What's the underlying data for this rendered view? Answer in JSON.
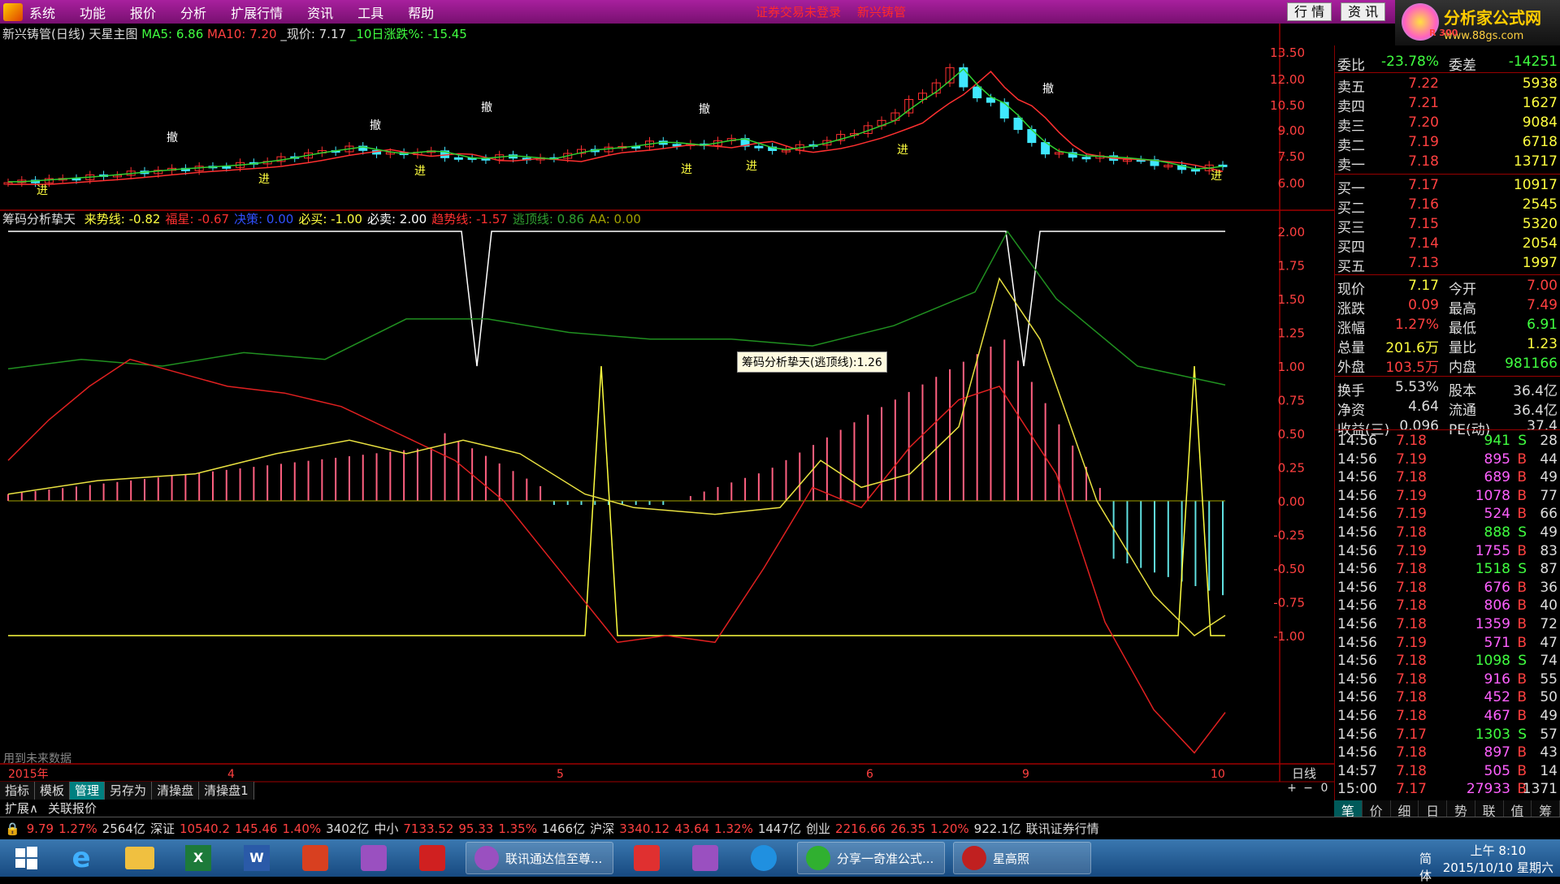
{
  "menu": {
    "items": [
      "系统",
      "功能",
      "报价",
      "分析",
      "扩展行情",
      "资讯",
      "工具",
      "帮助"
    ],
    "center_text": [
      "证券交易未登录",
      "新兴铸管"
    ],
    "btn_quote": "行 情",
    "btn_news": "资 讯"
  },
  "brand": {
    "name": "分析家公式网",
    "url": "www.88gs.com",
    "sub": "R 300"
  },
  "main_chart": {
    "title": "新兴铸管(日线) 天星主图",
    "ma5": "MA5: 6.86",
    "ma10": "MA10: 7.20",
    "price": "_现价: 7.17",
    "chg10": "_10日涨跌%: -15.45",
    "yticks": [
      "13.50",
      "12.00",
      "10.50",
      "9.00",
      "7.50",
      "6.00"
    ],
    "sig_top": "撤",
    "sig_bottom": "进"
  },
  "ind_chart": {
    "title": "筹码分析挚天",
    "items": [
      {
        "t": "来势线: -0.82",
        "c": "#ffff40"
      },
      {
        "t": "福星: -0.67",
        "c": "#ff3030"
      },
      {
        "t": "决策: 0.00",
        "c": "#3050ff"
      },
      {
        "t": "必买: -1.00",
        "c": "#ffff40"
      },
      {
        "t": "必卖: 2.00",
        "c": "#ffffff"
      },
      {
        "t": "趋势线: -1.57",
        "c": "#ff3030"
      },
      {
        "t": "逃顶线: 0.86",
        "c": "#30a030"
      },
      {
        "t": "AA: 0.00",
        "c": "#a0a000"
      }
    ],
    "yticks": [
      "2.00",
      "1.75",
      "1.50",
      "1.25",
      "1.00",
      "0.75",
      "0.50",
      "0.25",
      "0.00",
      "-0.25",
      "-0.50",
      "-0.75",
      "-1.00"
    ],
    "tooltip": "筹码分析挚天(逃顶线):1.26",
    "future_note": "用到未来数据"
  },
  "xaxis": {
    "year": "2015年",
    "months": [
      "4",
      "5",
      "6",
      "9",
      "10"
    ],
    "period": "日线"
  },
  "tabs": [
    "指标",
    "模板",
    "管理",
    "另存为",
    "清操盘",
    "清操盘1"
  ],
  "tabs2": [
    "扩展∧",
    "关联报价"
  ],
  "zoom": [
    "+",
    "−",
    "0"
  ],
  "quote": {
    "wb": {
      "l": "委比",
      "v": "-23.78%",
      "l2": "委差",
      "v2": "-14251"
    },
    "sells": [
      {
        "l": "卖五",
        "p": "7.22",
        "v": "5938"
      },
      {
        "l": "卖四",
        "p": "7.21",
        "v": "1627"
      },
      {
        "l": "卖三",
        "p": "7.20",
        "v": "9084"
      },
      {
        "l": "卖二",
        "p": "7.19",
        "v": "6718"
      },
      {
        "l": "卖一",
        "p": "7.18",
        "v": "13717"
      }
    ],
    "buys": [
      {
        "l": "买一",
        "p": "7.17",
        "v": "10917"
      },
      {
        "l": "买二",
        "p": "7.16",
        "v": "2545"
      },
      {
        "l": "买三",
        "p": "7.15",
        "v": "5320"
      },
      {
        "l": "买四",
        "p": "7.14",
        "v": "2054"
      },
      {
        "l": "买五",
        "p": "7.13",
        "v": "1997"
      }
    ],
    "stats": [
      {
        "l": "现价",
        "v": "7.17",
        "l2": "今开",
        "v2": "7.00",
        "c": "#ffff40",
        "c2": "#ff4040"
      },
      {
        "l": "涨跌",
        "v": "0.09",
        "l2": "最高",
        "v2": "7.49",
        "c": "#ff4040",
        "c2": "#ff4040"
      },
      {
        "l": "涨幅",
        "v": "1.27%",
        "l2": "最低",
        "v2": "6.91",
        "c": "#ff4040",
        "c2": "#40ff40"
      },
      {
        "l": "总量",
        "v": "201.6万",
        "l2": "量比",
        "v2": "1.23",
        "c": "#ffff40",
        "c2": "#ffff40"
      },
      {
        "l": "外盘",
        "v": "103.5万",
        "l2": "内盘",
        "v2": "981166",
        "c": "#ff4040",
        "c2": "#40ff40"
      }
    ],
    "fin": [
      {
        "l": "换手",
        "v": "5.53%",
        "l2": "股本",
        "v2": "36.4亿"
      },
      {
        "l": "净资",
        "v": "4.64",
        "l2": "流通",
        "v2": "36.4亿"
      },
      {
        "l": "收益(三)",
        "v": "0.096",
        "l2": "PE(动)",
        "v2": "37.4"
      }
    ]
  },
  "ticks": [
    {
      "t": "14:56",
      "p": "7.18",
      "v": "941",
      "d": "S",
      "n": "28"
    },
    {
      "t": "14:56",
      "p": "7.19",
      "v": "895",
      "d": "B",
      "n": "44"
    },
    {
      "t": "14:56",
      "p": "7.18",
      "v": "689",
      "d": "B",
      "n": "49"
    },
    {
      "t": "14:56",
      "p": "7.19",
      "v": "1078",
      "d": "B",
      "n": "77"
    },
    {
      "t": "14:56",
      "p": "7.19",
      "v": "524",
      "d": "B",
      "n": "66"
    },
    {
      "t": "14:56",
      "p": "7.18",
      "v": "888",
      "d": "S",
      "n": "49"
    },
    {
      "t": "14:56",
      "p": "7.19",
      "v": "1755",
      "d": "B",
      "n": "83"
    },
    {
      "t": "14:56",
      "p": "7.18",
      "v": "1518",
      "d": "S",
      "n": "87"
    },
    {
      "t": "14:56",
      "p": "7.18",
      "v": "676",
      "d": "B",
      "n": "36"
    },
    {
      "t": "14:56",
      "p": "7.18",
      "v": "806",
      "d": "B",
      "n": "40"
    },
    {
      "t": "14:56",
      "p": "7.18",
      "v": "1359",
      "d": "B",
      "n": "72"
    },
    {
      "t": "14:56",
      "p": "7.19",
      "v": "571",
      "d": "B",
      "n": "47"
    },
    {
      "t": "14:56",
      "p": "7.18",
      "v": "1098",
      "d": "S",
      "n": "74"
    },
    {
      "t": "14:56",
      "p": "7.18",
      "v": "916",
      "d": "B",
      "n": "55"
    },
    {
      "t": "14:56",
      "p": "7.18",
      "v": "452",
      "d": "B",
      "n": "50"
    },
    {
      "t": "14:56",
      "p": "7.18",
      "v": "467",
      "d": "B",
      "n": "49"
    },
    {
      "t": "14:56",
      "p": "7.17",
      "v": "1303",
      "d": "S",
      "n": "57"
    },
    {
      "t": "14:56",
      "p": "7.18",
      "v": "897",
      "d": "B",
      "n": "43"
    },
    {
      "t": "14:57",
      "p": "7.18",
      "v": "505",
      "d": "B",
      "n": "14"
    },
    {
      "t": "15:00",
      "p": "7.17",
      "v": "27933",
      "d": "B",
      "n": "1371"
    }
  ],
  "rtabs": [
    "笔",
    "价",
    "细",
    "日",
    "势",
    "联",
    "值",
    "筹"
  ],
  "status": [
    {
      "t": "9.79",
      "c": "#ff4040"
    },
    {
      "t": "1.27%",
      "c": "#ff4040"
    },
    {
      "t": "2564亿",
      "c": "#ddd"
    },
    {
      "t": "深证",
      "c": "#ddd"
    },
    {
      "t": "10540.2",
      "c": "#ff4040"
    },
    {
      "t": "145.46",
      "c": "#ff4040"
    },
    {
      "t": "1.40%",
      "c": "#ff4040"
    },
    {
      "t": "3402亿",
      "c": "#ddd"
    },
    {
      "t": "中小",
      "c": "#ddd"
    },
    {
      "t": "7133.52",
      "c": "#ff4040"
    },
    {
      "t": "95.33",
      "c": "#ff4040"
    },
    {
      "t": "1.35%",
      "c": "#ff4040"
    },
    {
      "t": "1466亿",
      "c": "#ddd"
    },
    {
      "t": "沪深",
      "c": "#ddd"
    },
    {
      "t": "3340.12",
      "c": "#ff4040"
    },
    {
      "t": "43.64",
      "c": "#ff4040"
    },
    {
      "t": "1.32%",
      "c": "#ff4040"
    },
    {
      "t": "1447亿",
      "c": "#ddd"
    },
    {
      "t": "创业",
      "c": "#ddd"
    },
    {
      "t": "2216.66",
      "c": "#ff4040"
    },
    {
      "t": "26.35",
      "c": "#ff4040"
    },
    {
      "t": "1.20%",
      "c": "#ff4040"
    },
    {
      "t": "922.1亿",
      "c": "#ddd"
    },
    {
      "t": "联讯证券行情",
      "c": "#ddd"
    }
  ],
  "taskbar": {
    "windows": [
      "联讯通达信至尊...",
      "分享一奇准公式...",
      "星高照"
    ],
    "ime": "简体",
    "time": "上午 8:10",
    "date": "2015/10/10 星期六"
  }
}
